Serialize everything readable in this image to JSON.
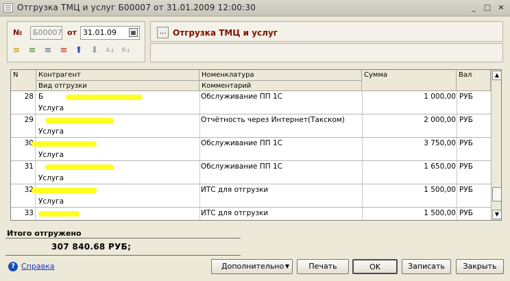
{
  "window": {
    "title": "Отгрузка ТМЦ и услуг Б00007 от 31.01.2009 12:00:30",
    "controls": {
      "minimize": "_",
      "maximize": "□",
      "close": "×"
    }
  },
  "header": {
    "number_label": "№",
    "number_value": "Б00007",
    "date_label": "от",
    "date_value": "31.01.09",
    "doc_type": "Отгрузка ТМЦ и услуг",
    "ellipsis": "..."
  },
  "toolbar": {
    "icons": [
      "add-row",
      "add-group",
      "move-row",
      "delete-row",
      "move-up",
      "move-down",
      "sort-asc",
      "sort-desc"
    ]
  },
  "table": {
    "headers": {
      "n": "N",
      "kontragent": "Контрагент",
      "vid": "Вид отгрузки",
      "nomenklatura": "Номенклатура",
      "comment": "Комментарий",
      "summa": "Сумма",
      "val": "Вал"
    },
    "rows": [
      {
        "n": "28",
        "kontragent": "Б",
        "vid": "Услуга",
        "nomenklatura": "Обслуживание ПП 1С",
        "summa": "1 000,00",
        "val": "РУБ"
      },
      {
        "n": "29",
        "kontragent": "",
        "vid": "Услуга",
        "nomenklatura": "Отчётность через Интернет(Такском)",
        "summa": "2 000,00",
        "val": "РУБ"
      },
      {
        "n": "30",
        "kontragent": "",
        "vid": "Услуга",
        "nomenklatura": "Обслуживание ПП 1С",
        "summa": "3 750,00",
        "val": "РУБ"
      },
      {
        "n": "31",
        "kontragent": "",
        "vid": "Услуга",
        "nomenklatura": "Обслуживание ПП 1С",
        "summa": "1 650,00",
        "val": "РУБ"
      },
      {
        "n": "32",
        "kontragent": "",
        "vid": "Услуга",
        "nomenklatura": "ИТС для отгрузки",
        "summa": "1 500,00",
        "val": "РУБ"
      },
      {
        "n": "33",
        "kontragent": "",
        "vid": "",
        "nomenklatura": "ИТС для отгрузки",
        "summa": "1 500,00",
        "val": "РУБ"
      }
    ]
  },
  "totals": {
    "label": "Итого отгружено",
    "value": "307 840.68 РУБ;"
  },
  "footer": {
    "help": "Справка",
    "help_icon": "?",
    "more": "Дополнительно",
    "print": "Печать",
    "ok": "OK",
    "save": "Записать",
    "close": "Закрыть"
  }
}
